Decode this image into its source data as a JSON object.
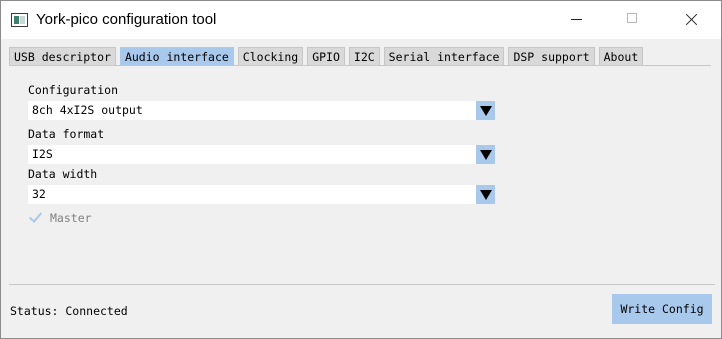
{
  "window": {
    "title": "York-pico configuration tool"
  },
  "tabs": [
    {
      "label": "USB descriptor",
      "active": false
    },
    {
      "label": "Audio interface",
      "active": true
    },
    {
      "label": "Clocking",
      "active": false
    },
    {
      "label": "GPIO",
      "active": false
    },
    {
      "label": "I2C",
      "active": false
    },
    {
      "label": "Serial interface",
      "active": false
    },
    {
      "label": "DSP support",
      "active": false
    },
    {
      "label": "About",
      "active": false
    }
  ],
  "form": {
    "configuration": {
      "label": "Configuration",
      "value": "8ch 4xI2S output"
    },
    "data_format": {
      "label": "Data format",
      "value": "I2S"
    },
    "data_width": {
      "label": "Data width",
      "value": "32"
    },
    "master": {
      "label": "Master",
      "checked": true
    }
  },
  "status": {
    "text": "Status: Connected"
  },
  "actions": {
    "write_config_label": "Write Config"
  },
  "colors": {
    "accent": "#a8c8ec",
    "tab_inactive": "#d9d9d9",
    "window_bg": "#f0f0f0"
  },
  "icons": {
    "app": "app-icon",
    "minimize": "minimize-icon",
    "maximize": "maximize-icon",
    "close": "close-icon",
    "dropdown": "triangle-down-icon",
    "check": "checkmark-icon"
  }
}
